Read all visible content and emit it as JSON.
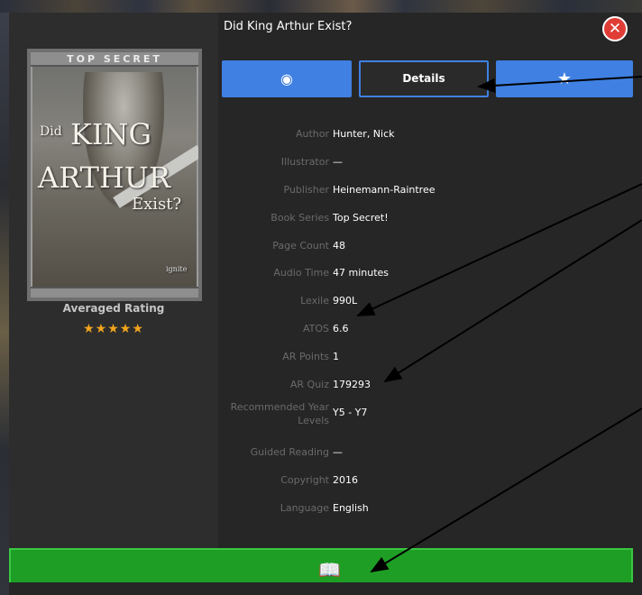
{
  "book": {
    "title": "Did King Arthur Exist?",
    "cover": {
      "band": "TOP SECRET",
      "did": "Did",
      "king": "KING",
      "arthur": "ARTHUR",
      "exist": "Exist?",
      "publisher_logo": "ignite"
    },
    "rating_label": "Averaged Rating",
    "stars": "★★★★★",
    "rating": 5
  },
  "tabs": {
    "read_icon": "eye-icon",
    "details_label": "Details",
    "favorite_icon": "star-icon"
  },
  "details": [
    {
      "key": "Author",
      "value": "Hunter, Nick"
    },
    {
      "key": "Illustrator",
      "value": "—"
    },
    {
      "key": "Publisher",
      "value": "Heinemann-Raintree"
    },
    {
      "key": "Book Series",
      "value": "Top Secret!"
    },
    {
      "key": "Page Count",
      "value": "48"
    },
    {
      "key": "Audio Time",
      "value": "47 minutes"
    },
    {
      "key": "Lexile",
      "value": "990L"
    },
    {
      "key": "ATOS",
      "value": "6.6"
    },
    {
      "key": "AR Points",
      "value": "1"
    },
    {
      "key": "AR Quiz",
      "value": "179293"
    },
    {
      "key": "Recommended Year Levels",
      "value": "Y5 - Y7"
    },
    {
      "key": "Guided Reading",
      "value": "—"
    },
    {
      "key": "Copyright",
      "value": "2016"
    },
    {
      "key": "Language",
      "value": "English"
    }
  ],
  "bottom": {
    "icon": "open-book-icon"
  },
  "colors": {
    "accent_blue": "#3f80e2",
    "open_green": "#1e9e25",
    "close_red": "#e03c36",
    "star_gold": "#f3a51d"
  }
}
